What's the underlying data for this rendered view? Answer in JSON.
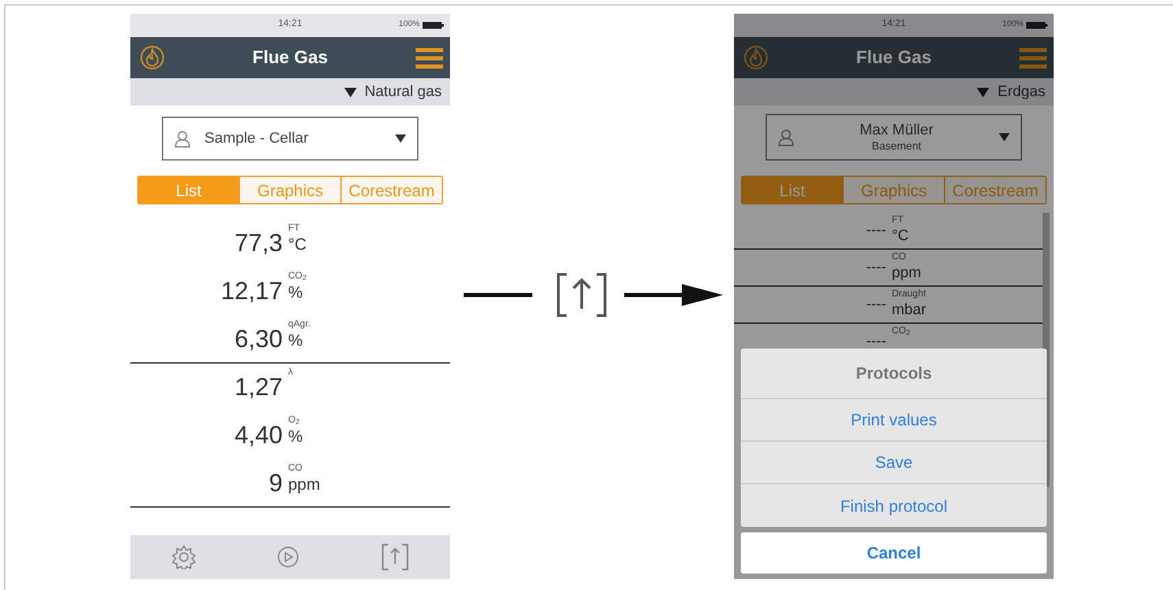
{
  "screens": [
    {
      "status_bar": {
        "time": "14:21",
        "battery": "100%"
      },
      "title": "Flue Gas",
      "fuel": "Natural gas",
      "customer": {
        "name": "Sample - Cellar"
      },
      "tabs": [
        {
          "label": "List",
          "selected": true
        },
        {
          "label": "Graphics",
          "selected": false
        },
        {
          "label": "Corestream",
          "selected": false
        }
      ],
      "readings": [
        {
          "value": "77,3",
          "label": "FT",
          "unit": "°C",
          "rule_below": false
        },
        {
          "value": "12,17",
          "label": "CO$_{2}$",
          "unit": "%",
          "rule_below": false
        },
        {
          "value": "6,30",
          "label": "qAgr.",
          "unit": "%",
          "rule_below": true
        },
        {
          "value": "1,27",
          "label": "λ",
          "rule_below": false
        },
        {
          "value": "4,40",
          "label": "O$_{2}$",
          "unit": "%",
          "rule_below": false
        },
        {
          "value": "9",
          "label": "CO",
          "unit": "ppm",
          "rule_below": true
        }
      ]
    },
    {
      "status_bar": {
        "time": "14:21",
        "battery": "100%"
      },
      "title": "Flue Gas",
      "fuel": "Erdgas",
      "customer": {
        "name": "Max Müller",
        "location": "Basement"
      },
      "tabs": [
        {
          "label": "List",
          "selected": true
        },
        {
          "label": "Graphics",
          "selected": false
        },
        {
          "label": "Corestream",
          "selected": false
        }
      ],
      "readings": [
        {
          "value": "----",
          "label": "FT",
          "unit": "°C",
          "rule_below": true
        },
        {
          "value": "----",
          "label": "CO",
          "unit": "ppm",
          "rule_below": true
        },
        {
          "value": "----",
          "label": "Draught",
          "unit": "mbar",
          "rule_below": true
        },
        {
          "value": "----",
          "label": "CO$_{2}$",
          "rule_below": false
        }
      ],
      "action_sheet": {
        "title": "Protocols",
        "actions": [
          "Print values",
          "Save",
          "Finish protocol"
        ],
        "cancel": "Cancel"
      }
    }
  ]
}
